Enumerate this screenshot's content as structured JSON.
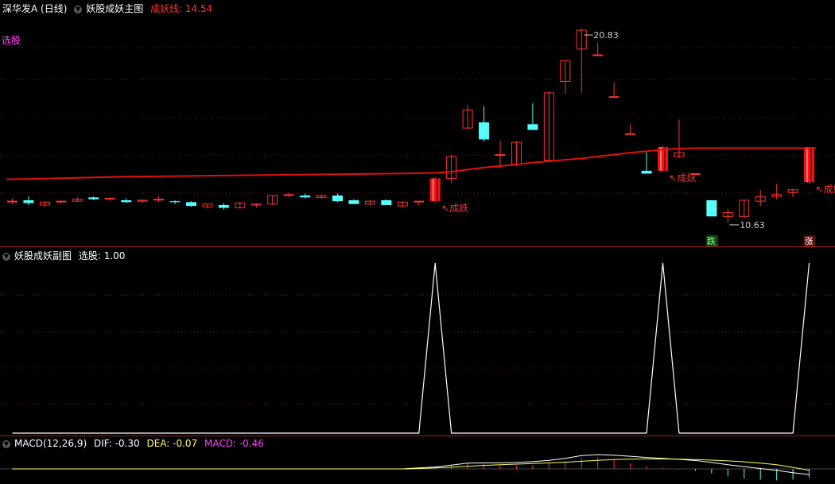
{
  "main": {
    "title": "深华发A (日线)",
    "indicator_name": "妖股成妖主图",
    "line_label": "成妖线: 14.54",
    "select_label": "选股",
    "high_label": "20.83",
    "low_label": "10.63",
    "signal_label": "成妖",
    "down_badge": "跌",
    "up_badge": "涨"
  },
  "sub": {
    "indicator_name": "妖股成妖副图",
    "value_label": "选股: 1.00"
  },
  "macd": {
    "name": "MACD(12,26,9)",
    "dif": "DIF: -0.30",
    "dea": "DEA: -0.07",
    "macd": "MACD: -0.46"
  },
  "colors": {
    "up": "#ff3232",
    "down": "#54ffff",
    "line": "#e01010",
    "grid": "#7a1010",
    "yellow": "#ffff60",
    "magenta": "#ff40ff"
  },
  "chart_data": {
    "type": "candlestick",
    "price_range": [
      10.0,
      21.5
    ],
    "candles": [
      {
        "o": 11.75,
        "h": 11.9,
        "l": 11.6,
        "c": 11.75
      },
      {
        "o": 11.8,
        "h": 12.0,
        "l": 11.55,
        "c": 11.65
      },
      {
        "o": 11.55,
        "h": 11.75,
        "l": 11.45,
        "c": 11.7
      },
      {
        "o": 11.75,
        "h": 11.8,
        "l": 11.6,
        "c": 11.75
      },
      {
        "o": 11.75,
        "h": 11.95,
        "l": 11.7,
        "c": 11.85
      },
      {
        "o": 11.95,
        "h": 12.0,
        "l": 11.8,
        "c": 11.85
      },
      {
        "o": 11.9,
        "h": 11.95,
        "l": 11.75,
        "c": 11.9
      },
      {
        "o": 11.8,
        "h": 11.9,
        "l": 11.65,
        "c": 11.7
      },
      {
        "o": 11.75,
        "h": 11.85,
        "l": 11.65,
        "c": 11.8
      },
      {
        "o": 11.85,
        "h": 12.0,
        "l": 11.7,
        "c": 11.85
      },
      {
        "o": 11.75,
        "h": 11.8,
        "l": 11.6,
        "c": 11.7
      },
      {
        "o": 11.7,
        "h": 11.75,
        "l": 11.45,
        "c": 11.5
      },
      {
        "o": 11.45,
        "h": 11.6,
        "l": 11.35,
        "c": 11.6
      },
      {
        "o": 11.55,
        "h": 11.65,
        "l": 11.3,
        "c": 11.4
      },
      {
        "o": 11.4,
        "h": 11.7,
        "l": 11.35,
        "c": 11.65
      },
      {
        "o": 11.55,
        "h": 11.65,
        "l": 11.4,
        "c": 11.6
      },
      {
        "o": 11.6,
        "h": 12.05,
        "l": 11.55,
        "c": 12.05
      },
      {
        "o": 12.05,
        "h": 12.2,
        "l": 11.95,
        "c": 12.1
      },
      {
        "o": 12.05,
        "h": 12.15,
        "l": 11.9,
        "c": 11.95
      },
      {
        "o": 11.95,
        "h": 12.1,
        "l": 11.9,
        "c": 12.05
      },
      {
        "o": 12.05,
        "h": 12.15,
        "l": 11.7,
        "c": 11.75
      },
      {
        "o": 11.8,
        "h": 11.85,
        "l": 11.6,
        "c": 11.6
      },
      {
        "o": 11.6,
        "h": 11.8,
        "l": 11.55,
        "c": 11.75
      },
      {
        "o": 11.8,
        "h": 11.85,
        "l": 11.55,
        "c": 11.55
      },
      {
        "o": 11.5,
        "h": 11.75,
        "l": 11.4,
        "c": 11.7
      },
      {
        "o": 11.75,
        "h": 11.75,
        "l": 11.55,
        "c": 11.75
      },
      {
        "o": 11.75,
        "h": 13.0,
        "l": 11.65,
        "c": 12.95,
        "limit": true
      },
      {
        "o": 12.95,
        "h": 14.2,
        "l": 12.7,
        "c": 14.1
      },
      {
        "o": 15.6,
        "h": 16.8,
        "l": 15.5,
        "c": 16.55
      },
      {
        "o": 15.9,
        "h": 16.75,
        "l": 14.9,
        "c": 15.0
      },
      {
        "o": 14.2,
        "h": 14.95,
        "l": 13.5,
        "c": 14.2
      },
      {
        "o": 13.7,
        "h": 14.9,
        "l": 13.6,
        "c": 14.85
      },
      {
        "o": 15.8,
        "h": 16.9,
        "l": 15.5,
        "c": 15.5
      },
      {
        "o": 13.9,
        "h": 17.55,
        "l": 13.8,
        "c": 17.45
      },
      {
        "o": 18.05,
        "h": 19.15,
        "l": 17.4,
        "c": 19.15
      },
      {
        "o": 19.75,
        "h": 20.83,
        "l": 17.45,
        "c": 20.75
      },
      {
        "o": 19.45,
        "h": 20.1,
        "l": 19.4,
        "c": 19.45
      },
      {
        "o": 17.25,
        "h": 18.0,
        "l": 17.25,
        "c": 17.25
      },
      {
        "o": 15.3,
        "h": 15.8,
        "l": 15.3,
        "c": 15.3
      },
      {
        "o": 13.35,
        "h": 14.4,
        "l": 13.2,
        "c": 13.2
      },
      {
        "o": 13.35,
        "h": 14.65,
        "l": 13.3,
        "c": 14.6,
        "limit": true
      },
      {
        "o": 14.1,
        "h": 16.05,
        "l": 14.0,
        "c": 14.3
      },
      {
        "o": 13.2,
        "h": 13.2,
        "l": 13.2,
        "c": 13.2
      },
      {
        "o": 11.8,
        "h": 11.8,
        "l": 10.95,
        "c": 10.95
      },
      {
        "o": 10.95,
        "h": 11.35,
        "l": 10.63,
        "c": 11.15
      },
      {
        "o": 10.95,
        "h": 11.8,
        "l": 10.9,
        "c": 11.8
      },
      {
        "o": 11.75,
        "h": 12.35,
        "l": 11.5,
        "c": 12.0
      },
      {
        "o": 12.0,
        "h": 12.65,
        "l": 11.85,
        "c": 12.1
      },
      {
        "o": 12.2,
        "h": 12.4,
        "l": 11.95,
        "c": 12.35
      },
      {
        "o": 12.75,
        "h": 14.6,
        "l": 12.65,
        "c": 14.6,
        "limit": true
      }
    ],
    "line_series": {
      "name": "成妖线",
      "values": [
        12.9,
        12.92,
        12.94,
        12.96,
        12.98,
        13.0,
        13.02,
        13.04,
        13.05,
        13.06,
        13.07,
        13.08,
        13.09,
        13.1,
        13.11,
        13.12,
        13.13,
        13.14,
        13.15,
        13.16,
        13.17,
        13.18,
        13.19,
        13.2,
        13.21,
        13.22,
        13.24,
        13.3,
        13.42,
        13.52,
        13.6,
        13.68,
        13.78,
        13.85,
        13.93,
        14.0,
        14.1,
        14.2,
        14.3,
        14.38,
        14.47,
        14.52,
        14.54,
        14.54,
        14.54,
        14.54,
        14.54,
        14.54,
        14.54,
        14.54
      ]
    },
    "sub_series": {
      "name": "选股",
      "values": [
        0,
        0,
        0,
        0,
        0,
        0,
        0,
        0,
        0,
        0,
        0,
        0,
        0,
        0,
        0,
        0,
        0,
        0,
        0,
        0,
        0,
        0,
        0,
        0,
        0,
        0,
        1,
        0,
        0,
        0,
        0,
        0,
        0,
        0,
        0,
        0,
        0,
        0,
        0,
        0,
        1,
        0,
        0,
        0,
        0,
        0,
        0,
        0,
        0,
        1
      ]
    },
    "macd_series": {
      "dif": [
        0,
        0,
        0,
        0,
        0,
        0,
        0,
        0,
        0,
        0,
        0,
        0,
        0,
        0,
        0,
        0,
        0,
        0,
        0,
        0,
        0,
        0,
        0,
        0,
        0,
        0.05,
        0.1,
        0.2,
        0.3,
        0.32,
        0.32,
        0.34,
        0.38,
        0.45,
        0.55,
        0.7,
        0.75,
        0.72,
        0.66,
        0.6,
        0.55,
        0.5,
        0.44,
        0.34,
        0.22,
        0.12,
        0.02,
        -0.08,
        -0.2,
        -0.3
      ],
      "dea": [
        0,
        0,
        0,
        0,
        0,
        0,
        0,
        0,
        0,
        0,
        0,
        0,
        0,
        0,
        0,
        0,
        0,
        0,
        0,
        0,
        0,
        0,
        0,
        0,
        0,
        0.02,
        0.05,
        0.09,
        0.14,
        0.18,
        0.22,
        0.25,
        0.28,
        0.31,
        0.35,
        0.4,
        0.45,
        0.49,
        0.51,
        0.52,
        0.52,
        0.51,
        0.49,
        0.46,
        0.42,
        0.37,
        0.3,
        0.22,
        0.08,
        -0.07
      ]
    }
  }
}
